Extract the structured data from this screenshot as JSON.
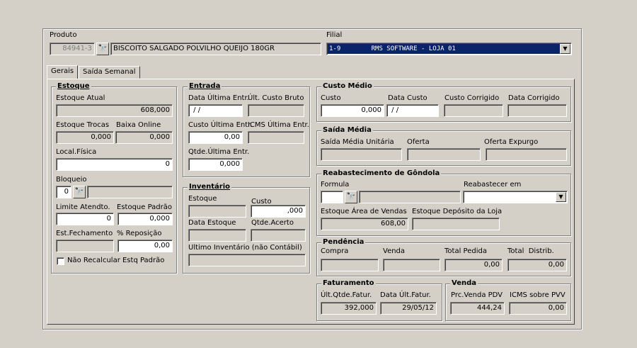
{
  "produto": {
    "label": "Produto",
    "codigo": "84941-3",
    "descricao": "BISCOITO SALGADO POLVILHO QUEIJO 180GR"
  },
  "filial": {
    "label": "Filial",
    "value": "1-9        RMS SOFTWARE - LOJA 01"
  },
  "tabs": [
    {
      "label": "Gerais"
    },
    {
      "label": "Saída Semanal"
    }
  ],
  "estoque": {
    "title": "Estoque",
    "atual_label": "Estoque Atual",
    "atual_value": "608,000",
    "trocas_label": "Estoque Trocas",
    "trocas_value": "0,000",
    "baixa_label": "Baixa Online",
    "baixa_value": "0,000",
    "local_label": "Local.Física",
    "local_value": "0",
    "bloqueio_label": "Bloqueio",
    "bloqueio_value": "0",
    "bloqueio_desc": "",
    "limite_label": "Limite Atendto.",
    "limite_value": "0",
    "padrao_label": "Estoque Padrão",
    "padrao_value": "0,000",
    "fechamento_label": "Est.Fechamento",
    "fechamento_value": "",
    "reposicao_label": "% Reposição",
    "reposicao_value": "0,00",
    "nao_recalcular_label": "Não Recalcular Estq Padrão"
  },
  "entrada": {
    "title": "Entrada",
    "data_ultima_label": "Data Última Entr.",
    "data_ultima_value": " / /",
    "custo_bruto_label": "Últ. Custo Bruto",
    "custo_bruto_value": "",
    "custo_ultima_label": "Custo Última Entr.",
    "custo_ultima_value": "0,00",
    "icms_label": "ICMS Última Entr.",
    "icms_value": "",
    "qtde_label": "Qtde.Última Entr.",
    "qtde_value": "0,000"
  },
  "inventario": {
    "title": "Inventário",
    "estoque_label": "Estoque",
    "estoque_value": "",
    "custo_label": "Custo",
    "custo_value": ",000",
    "data_estoque_label": "Data Estoque",
    "data_estoque_value": "",
    "qtde_acerto_label": "Qtde.Acerto",
    "qtde_acerto_value": "",
    "ultimo_label": "Ultimo Inventário (não Contábil)",
    "ultimo_value": ""
  },
  "custo_medio": {
    "title": "Custo Médio",
    "custo_label": "Custo",
    "custo_value": "0,000",
    "data_custo_label": "Data Custo",
    "data_custo_value": " / /",
    "corrigido_label": "Custo Corrigido",
    "corrigido_value": "",
    "data_corrigido_label": "Data Corrigido",
    "data_corrigido_value": ""
  },
  "saida_media": {
    "title": "Saída Média",
    "unitaria_label": "Saída Média Unitária",
    "unitaria_value": "",
    "oferta_label": "Oferta",
    "oferta_value": "",
    "expurgo_label": "Oferta Expurgo",
    "expurgo_value": ""
  },
  "reabastecimento": {
    "title": "Reabastecimento de Gôndola",
    "formula_label": "Formula",
    "formula_value": "",
    "formula_desc": "",
    "reabastecer_label": "Reabastecer em",
    "reabastecer_value": "",
    "area_label": "Estoque Área de Vendas",
    "area_value": "608,00",
    "deposito_label": "Estoque Depósito da Loja",
    "deposito_value": ""
  },
  "pendencia": {
    "title": "Pendência",
    "compra_label": "Compra",
    "compra_value": "",
    "venda_label": "Venda",
    "venda_value": "",
    "total_pedida_label": "Total Pedida",
    "total_pedida_value": "0,00",
    "total_distrib_label": "Total  Distrib.",
    "total_distrib_value": "0,00"
  },
  "faturamento": {
    "title": "Faturamento",
    "qtde_label": "Últ.Qtde.Fatur.",
    "qtde_value": "392,000",
    "data_label": "Data Últ.Fatur.",
    "data_value": "29/05/12"
  },
  "venda": {
    "title": "Venda",
    "prc_label": "Prc.Venda PDV",
    "prc_value": "444,24",
    "icms_label": "ICMS sobre PVV",
    "icms_value": "0,00"
  },
  "icons": {
    "search": "binoculars-icon",
    "dropdown": "chevron-down-icon"
  }
}
